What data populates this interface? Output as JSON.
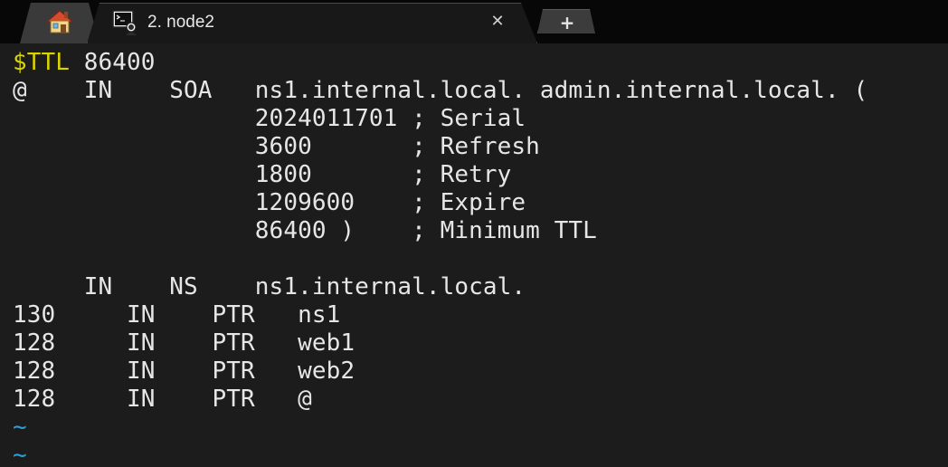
{
  "window": {
    "active_tab_title": "2. node2",
    "close_glyph": "✕",
    "new_tab_glyph": "+"
  },
  "icons": {
    "home_tab": "home-icon",
    "terminal_tab": "terminal-session-icon",
    "close": "close-icon",
    "new_tab": "plus-icon"
  },
  "colors": {
    "background": "#1c1c1c",
    "text": "#e6e6e6",
    "variable": "#d9d300",
    "tilde": "#2aa1d6"
  },
  "terminal": {
    "ttl_var": "$TTL",
    "ttl_value": " 86400",
    "lines": [
      "@    IN    SOA   ns1.internal.local. admin.internal.local. (",
      "                 2024011701 ; Serial",
      "                 3600       ; Refresh",
      "                 1800       ; Retry",
      "                 1209600    ; Expire",
      "                 86400 )    ; Minimum TTL",
      "",
      "     IN    NS    ns1.internal.local.",
      "130     IN    PTR   ns1",
      "128     IN    PTR   web1",
      "128     IN    PTR   web2",
      "128     IN    PTR   @"
    ],
    "tildes": [
      "~",
      "~"
    ]
  }
}
